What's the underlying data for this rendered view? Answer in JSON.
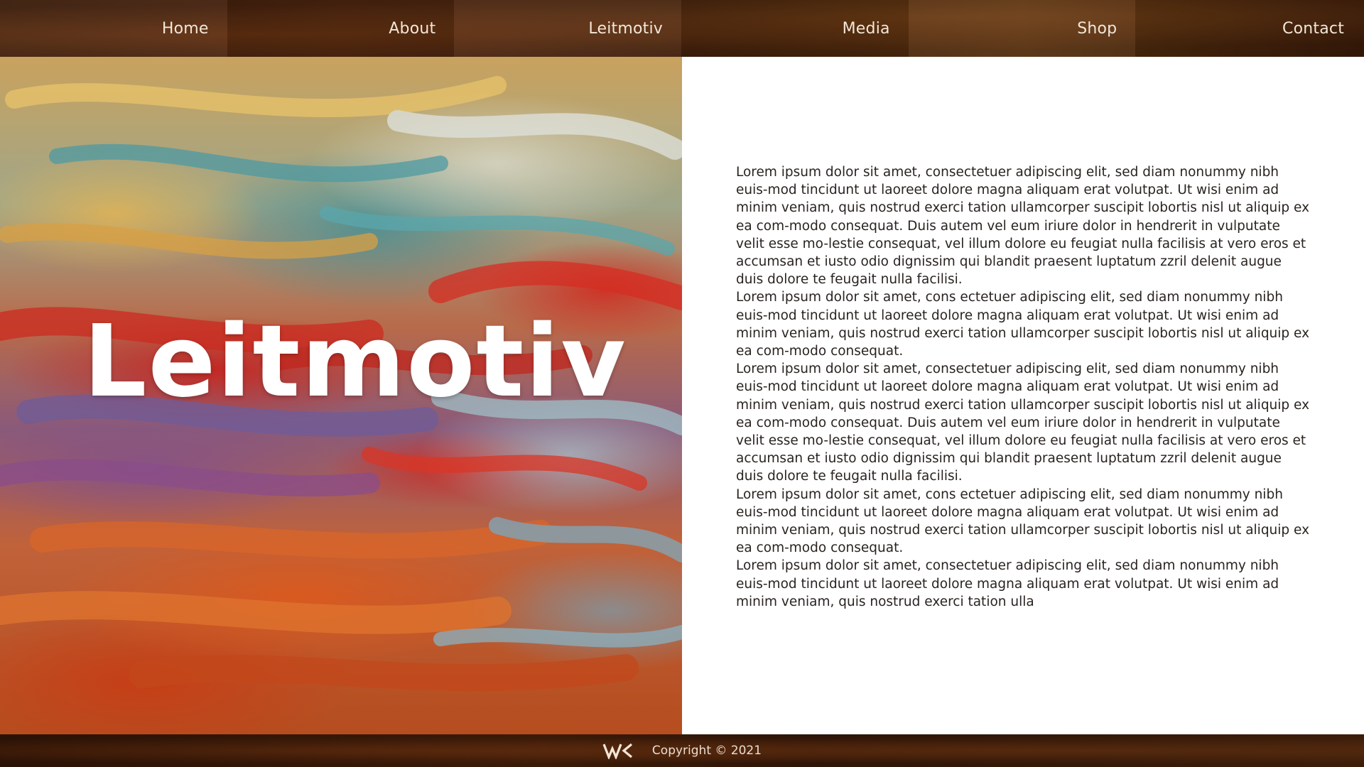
{
  "nav": {
    "items": [
      {
        "label": "Home"
      },
      {
        "label": "About"
      },
      {
        "label": "Leitmotiv"
      },
      {
        "label": "Media"
      },
      {
        "label": "Shop"
      },
      {
        "label": "Contact"
      }
    ]
  },
  "hero": {
    "title": "Leitmotiv"
  },
  "content": {
    "paragraphs": [
      "Lorem ipsum dolor sit amet, consectetuer adipiscing elit, sed diam nonummy nibh euis-mod tincidunt ut laoreet dolore magna aliquam erat volutpat. Ut wisi enim ad minim veniam, quis nostrud exerci tation ullamcorper suscipit lobortis nisl ut aliquip ex ea com-modo consequat. Duis autem vel eum iriure dolor in hendrerit in vulputate velit esse mo-lestie consequat, vel illum dolore eu feugiat nulla facilisis at vero eros et accumsan et iusto odio dignissim qui blandit praesent luptatum zzril delenit augue duis dolore te feugait nulla facilisi.",
      "Lorem ipsum dolor sit amet, cons ectetuer adipiscing elit, sed diam nonummy nibh euis-mod tincidunt ut laoreet dolore magna aliquam erat volutpat. Ut wisi enim ad minim veniam, quis nostrud exerci tation ullamcorper suscipit lobortis nisl ut aliquip ex ea com-modo consequat.",
      "Lorem ipsum dolor sit amet, consectetuer adipiscing elit, sed diam nonummy nibh euis-mod tincidunt ut laoreet dolore magna aliquam erat volutpat. Ut wisi enim ad minim veniam, quis nostrud exerci tation ullamcorper suscipit lobortis nisl ut aliquip ex ea com-modo consequat. Duis autem vel eum iriure dolor in hendrerit in vulputate velit esse mo-lestie consequat, vel illum dolore eu feugiat nulla facilisis at vero eros et accumsan et iusto odio dignissim qui blandit praesent luptatum zzril delenit augue duis dolore te feugait nulla facilisi.",
      "Lorem ipsum dolor sit amet, cons ectetuer adipiscing elit, sed diam nonummy nibh euis-mod tincidunt ut laoreet dolore magna aliquam erat volutpat. Ut wisi enim ad minim veniam, quis nostrud exerci tation ullamcorper suscipit lobortis nisl ut aliquip ex ea com-modo consequat.",
      "Lorem ipsum dolor sit amet, consectetuer adipiscing elit, sed diam nonummy nibh euis-mod tincidunt ut laoreet dolore magna aliquam erat volutpat. Ut wisi enim ad minim veniam, quis nostrud exerci tation ulla"
    ]
  },
  "footer": {
    "logo_icon": "wk-logo-icon",
    "copyright": "Copyright © 2021"
  },
  "colors": {
    "nav_text": "#f3e6d8",
    "body_text": "#2a2320",
    "content_bg": "#ffffff",
    "hero_title": "#ffffff"
  }
}
